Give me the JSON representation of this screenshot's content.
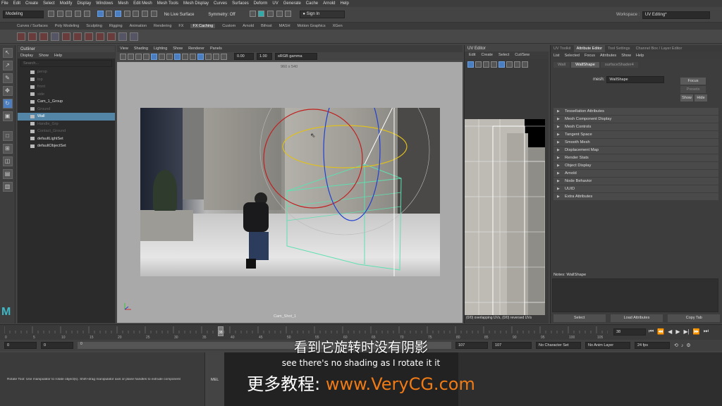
{
  "menubar": {
    "items": [
      "File",
      "Edit",
      "Create",
      "Select",
      "Modify",
      "Display",
      "Windows",
      "Mesh",
      "Edit Mesh",
      "Mesh Tools",
      "Mesh Display",
      "Curves",
      "Surfaces",
      "Deform",
      "UV",
      "Generate",
      "Cache",
      "Arnold",
      "Help"
    ],
    "workspace_label": "Workspace :",
    "workspace_value": "UV Editing*"
  },
  "statusline": {
    "mode": "Modeling",
    "live_surface": "No Live Surface",
    "symmetry": "Symmetry: Off",
    "sign_in": "Sign In"
  },
  "shelf_tabs": [
    "Curves / Surfaces",
    "Poly Modeling",
    "Sculpting",
    "Rigging",
    "Animation",
    "Rendering",
    "FX",
    "FX Caching",
    "Custom",
    "Arnold",
    "Bifrost",
    "MASH",
    "Motion Graphics",
    "XGen"
  ],
  "shelf_active": "FX Caching",
  "outliner": {
    "title": "Outliner",
    "menu": [
      "Display",
      "Show",
      "Help"
    ],
    "search_placeholder": "Search...",
    "items": [
      {
        "label": "persp",
        "dim": true
      },
      {
        "label": "top",
        "dim": true
      },
      {
        "label": "front",
        "dim": true
      },
      {
        "label": "side",
        "dim": true
      },
      {
        "label": "Cam_1_Group",
        "dim": false
      },
      {
        "label": "Ground",
        "dim": true
      },
      {
        "label": "Wall",
        "dim": false,
        "selected": true
      },
      {
        "label": "Handle_Grp",
        "dim": true
      },
      {
        "label": "Contact_Ground",
        "dim": true
      },
      {
        "label": "defaultLightSet",
        "dim": false
      },
      {
        "label": "defaultObjectSet",
        "dim": false
      }
    ]
  },
  "viewport": {
    "menu": [
      "View",
      "Shading",
      "Lighting",
      "Show",
      "Renderer",
      "Panels"
    ],
    "exposure": "0.00",
    "gamma": "1.00",
    "color_space": "sRGB gamma",
    "resolution": "960 x 540",
    "camera_label": "Cam_Shot_1"
  },
  "uv_editor": {
    "title": "UV Editor",
    "menu": [
      "Edit",
      "Create",
      "Select",
      "Cut/Sew"
    ],
    "status": "(0/0) overlapping UVs, (0/0) reversed UVs"
  },
  "attribute_editor": {
    "tabs": [
      "UV Toolkit",
      "Attribute Editor",
      "Tool Settings",
      "Channel Box / Layer Editor"
    ],
    "active_tab": "Attribute Editor",
    "menu": [
      "List",
      "Selected",
      "Focus",
      "Attributes",
      "Show",
      "Help"
    ],
    "node_tabs": [
      "Wall",
      "WallShape",
      "surfaceShader4"
    ],
    "active_node_tab": "WallShape",
    "mesh_label": "mesh:",
    "mesh_value": "WallShape",
    "focus": "Focus",
    "presets": "Presets",
    "show": "Show",
    "hide": "Hide",
    "sections": [
      "Tessellation Attributes",
      "Mesh Component Display",
      "Mesh Controls",
      "Tangent Space",
      "Smooth Mesh",
      "Displacement Map",
      "Render Stats",
      "Object Display",
      "Arnold",
      "Node Behavior",
      "UUID",
      "Extra Attributes"
    ],
    "notes_label": "Notes:",
    "notes_value": "WallShape",
    "buttons": [
      "Select",
      "Load Attributes",
      "Copy Tab"
    ]
  },
  "timeline": {
    "ticks": [
      "0",
      "5",
      "10",
      "15",
      "20",
      "25",
      "30",
      "35",
      "40",
      "45",
      "50",
      "55",
      "60",
      "65",
      "70",
      "75",
      "80",
      "85",
      "90",
      "95",
      "100",
      "105"
    ],
    "current_frame": "38",
    "current_frame_field": "38",
    "range_start": "0",
    "range_inner_start": "0",
    "range_inner_end": "107",
    "range_end": "107",
    "range_bar_start": "0",
    "character_set": "No Character Set",
    "anim_layer": "No Anim Layer",
    "fps": "24 fps"
  },
  "command_line": {
    "mel_label": "MEL",
    "help_text": "Rotate Tool: Use manipulator to rotate object(s). Shift+drag manipulator axis or plane handles to extrude component"
  },
  "subtitles": {
    "line1": "看到它旋转时没有阴影",
    "line2": "see there's no shading as I rotate it it",
    "line3_prefix": "更多教程: ",
    "line3_url": "www.VeryCG.com"
  },
  "colors": {
    "selection_blue": "#5285a6",
    "accent_blue": "#4b7ec0",
    "watermark_orange": "#f07b15"
  }
}
